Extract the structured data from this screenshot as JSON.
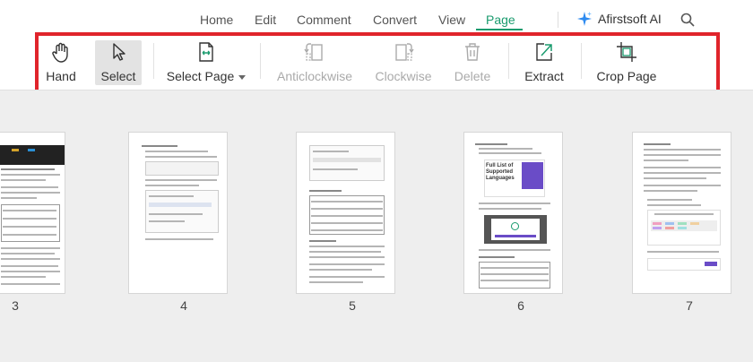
{
  "menu": {
    "tabs": [
      "Home",
      "Edit",
      "Comment",
      "Convert",
      "View",
      "Page"
    ],
    "active_tab": "Page",
    "ai_label": "Afirstsoft AI"
  },
  "toolbar": {
    "hand": "Hand",
    "select": "Select",
    "select_page": "Select Page",
    "anticlockwise": "Anticlockwise",
    "clockwise": "Clockwise",
    "delete": "Delete",
    "extract": "Extract",
    "crop_page": "Crop Page"
  },
  "thumbnails": {
    "page_numbers": [
      "3",
      "4",
      "5",
      "6",
      "7"
    ],
    "page6_heading": "Full List of Supported Languages"
  },
  "colors": {
    "accent": "#1a9b6e",
    "highlight_border": "#e0242b",
    "workspace_bg": "#eeeeee",
    "purple": "#6a4cc7"
  }
}
